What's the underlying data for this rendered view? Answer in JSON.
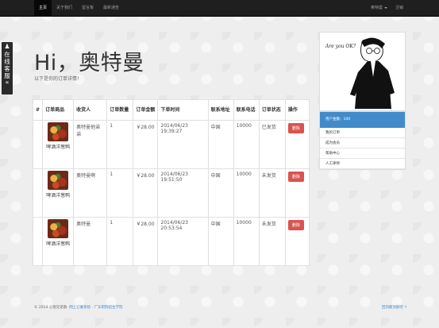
{
  "nav": {
    "left": [
      "主页",
      "关于我们",
      "留言板",
      "最新通告"
    ],
    "user": "奥特曼",
    "logout": "注销"
  },
  "kefu": {
    "icon": "♟",
    "text": "在线客服",
    "arrow": "«"
  },
  "hero": {
    "title": "Hi，奥特曼",
    "subtitle": "以下是你的订单详情！"
  },
  "table": {
    "headers": [
      "#",
      "订单商品",
      "收货人",
      "订单数量",
      "订单金额",
      "下单时间",
      "联系地址",
      "联系电话",
      "订单状态",
      "操作"
    ],
    "rows": [
      {
        "product": "啤酒洋葱鸭",
        "receiver": "奥特曼他弟弟",
        "qty": "1",
        "amount": "￥28.00",
        "time": "2014/06/23 19:39:27",
        "address": "中国",
        "phone": "10000",
        "status": "已发货",
        "action": "删除"
      },
      {
        "product": "啤酒洋葱鸭",
        "receiver": "奥特曼啊",
        "qty": "1",
        "amount": "￥28.00",
        "time": "2014/06/23 19:51:50",
        "address": "中国",
        "phone": "10000",
        "status": "未发货",
        "action": "删除"
      },
      {
        "product": "啤酒洋葱鸭",
        "receiver": "奥特曼",
        "qty": "1",
        "amount": "￥28.00",
        "time": "2014/06/23 20:53:54",
        "address": "中国",
        "phone": "10000",
        "status": "未发货",
        "action": "删除"
      }
    ]
  },
  "sidebar": {
    "avatar_caption": "Are you OK?",
    "items": [
      "用户金额：100",
      "我的订单",
      "成为会员",
      "帮助中心",
      "人工律师"
    ]
  },
  "footer": {
    "copyright": "© 2014 心悦兄弟歌.",
    "links": "网上订餐系统 · 广东职院招生学院",
    "back_to_top": "回到最顶部吧 ↑"
  },
  "colors": {
    "navbar": "#1f1f1f",
    "primary": "#428bca",
    "danger": "#d9534f"
  }
}
